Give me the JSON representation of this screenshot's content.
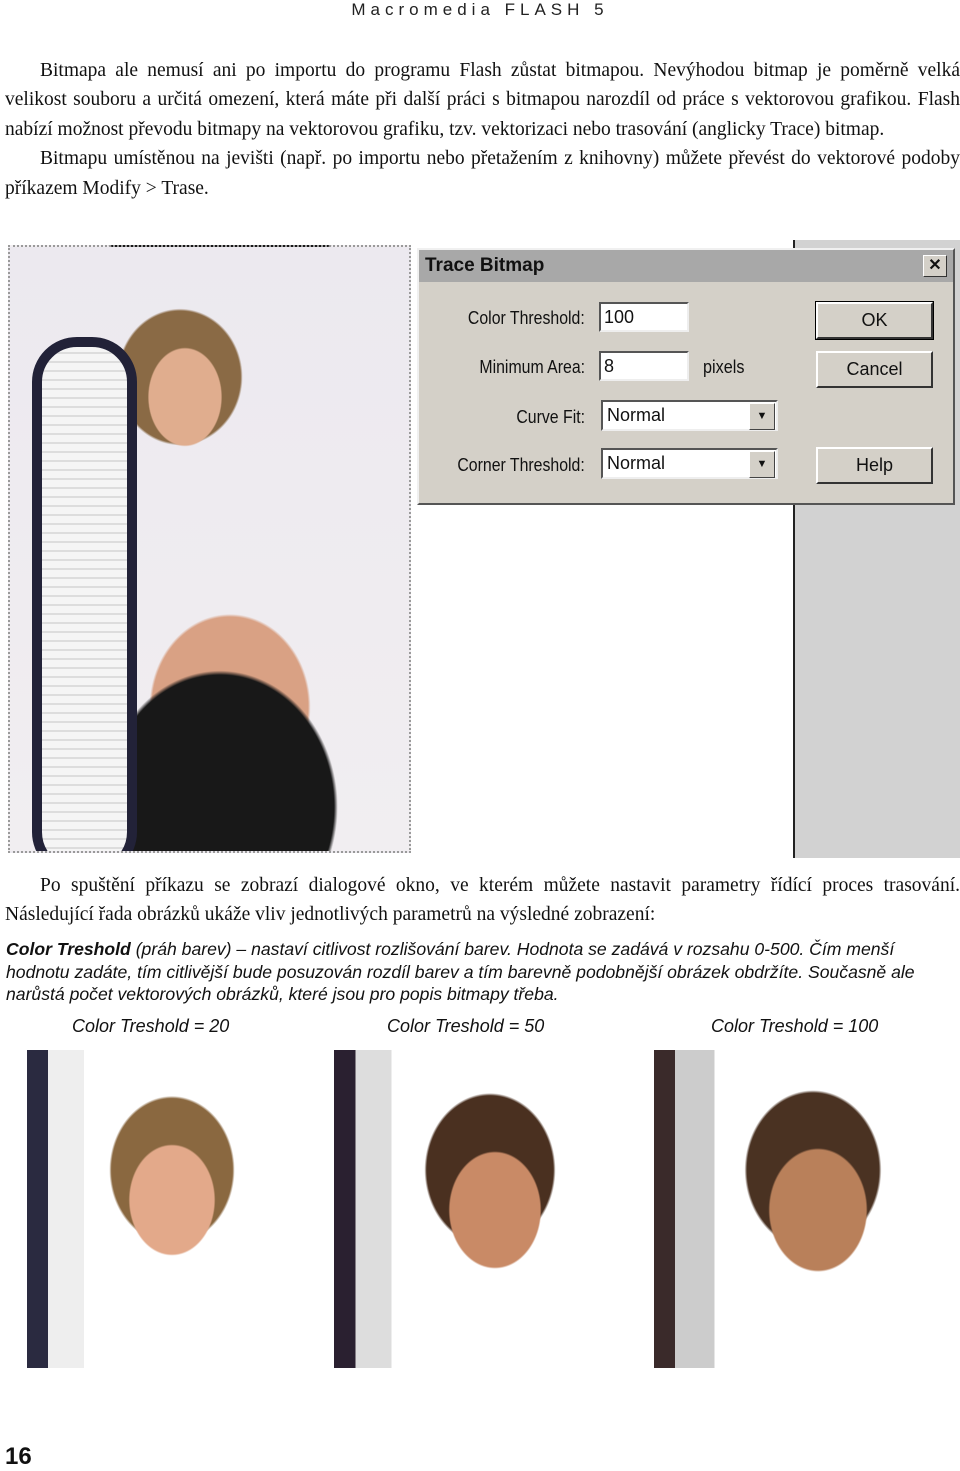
{
  "header": "Macromedia FLASH 5",
  "intro": [
    "Bitmapa ale nemusí ani po importu do programu Flash zůstat bitmapou. Nevýhodou bitmap je poměrně velká velikost souboru a určitá omezení, která máte při další práci s bitmapou narozdíl od práce s vektorovou grafikou. Flash nabízí možnost převodu bitmapy na vektorovou grafiku, tzv. vektorizaci nebo trasování (anglicky Trace) bitmap.",
    "Bitmapu umístěnou na jevišti (např. po importu nebo přetažením z knihovny) můžete převést do vektorové podoby příkazem Modify > Trase."
  ],
  "dialog": {
    "title": "Trace Bitmap",
    "close": "✕",
    "color_threshold_label": "Color Threshold:",
    "color_threshold_value": "100",
    "minimum_area_label": "Minimum Area:",
    "minimum_area_value": "8",
    "pixels_label": "pixels",
    "curve_fit_label": "Curve Fit:",
    "curve_fit_value": "Normal",
    "corner_threshold_label": "Corner Threshold:",
    "corner_threshold_value": "Normal",
    "ok": "OK",
    "cancel": "Cancel",
    "help": "Help"
  },
  "after": "Po spuštění příkazu se zobrazí dialogové okno, ve kterém můžete nastavit parametry řídící proces trasování. Následující řada obrázků ukáže vliv jednotlivých parametrů na výsledné zobrazení:",
  "note": {
    "term": "Color Treshold",
    "text": " (práh barev) – nastaví citlivost rozlišování barev. Hodnota se zadává v rozsahu 0-500. Čím menší hodnotu zadáte, tím citlivější bude posuzován rozdíl barev a tím barevně podobnější obrázek obdržíte. Současně ale narůstá počet vektorových obrázků, které jsou pro popis bitmapy třeba."
  },
  "captions": [
    "Color Treshold = 20",
    "Color Treshold = 50",
    "Color Treshold = 100"
  ],
  "page_number": "16"
}
